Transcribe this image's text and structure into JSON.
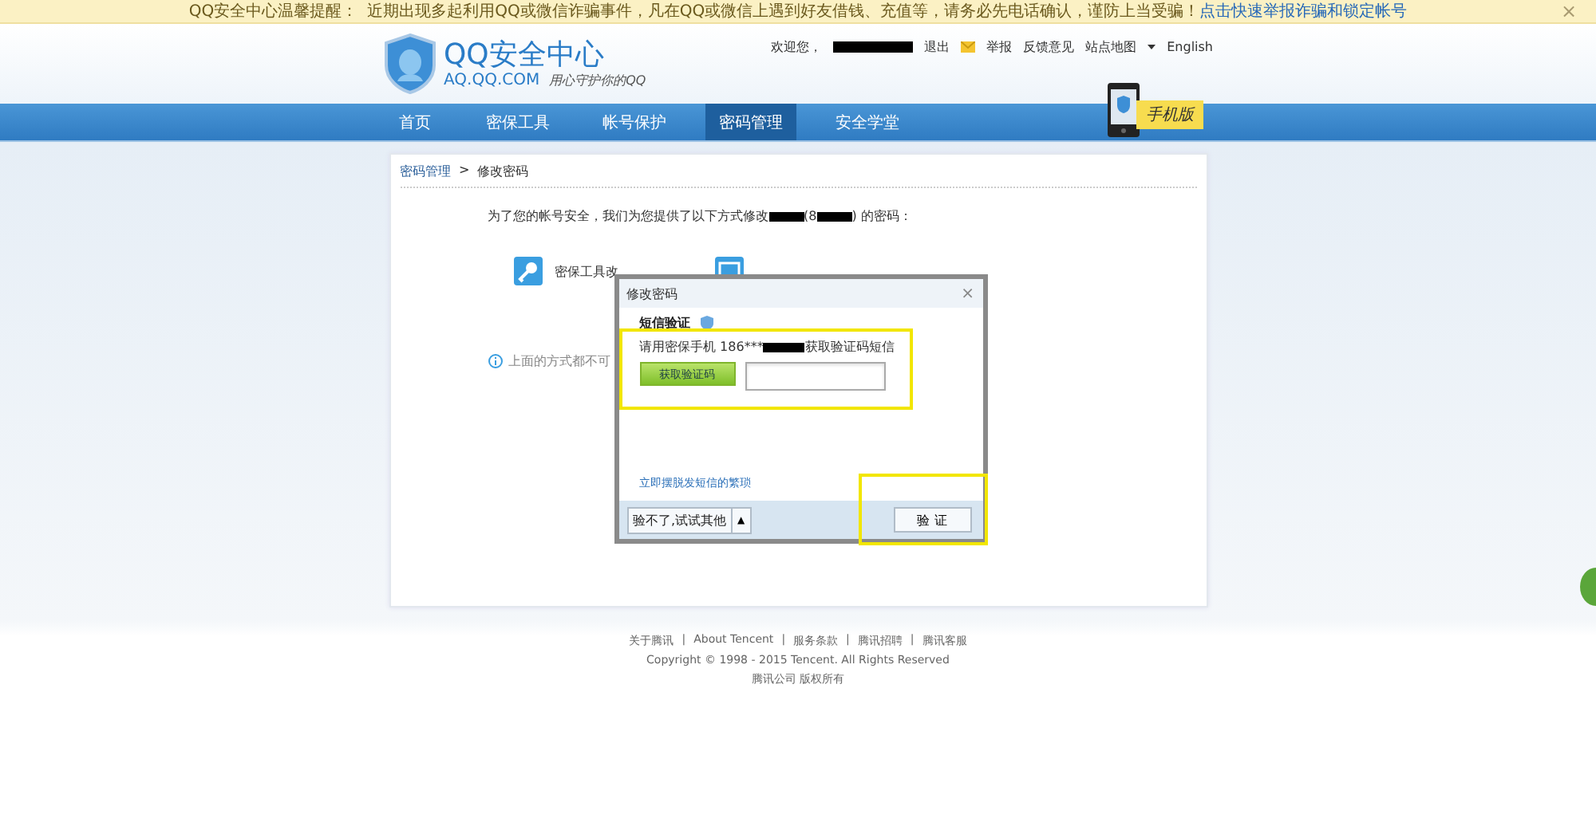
{
  "notice": {
    "label": "QQ安全中心温馨提醒：",
    "text": "近期出现多起利用QQ或微信诈骗事件，凡在QQ或微信上遇到好友借钱、充值等，请务必先电话确认，谨防上当受骗！",
    "link": "点击快速举报诈骗和锁定帐号",
    "close": "×"
  },
  "logo": {
    "title": "QQ安全中心",
    "domain": "AQ.QQ.COM",
    "slogan": "用心守护你的QQ"
  },
  "top_links": {
    "welcome": "欢迎您，",
    "items": [
      {
        "label": "退出",
        "kind": "link"
      },
      {
        "label": "举报",
        "kind": "mail-link"
      },
      {
        "label": "反馈意见",
        "kind": "link"
      },
      {
        "label": "站点地图",
        "kind": "dropdown"
      },
      {
        "label": "English",
        "kind": "link"
      }
    ]
  },
  "nav": [
    {
      "label": "首页",
      "selected": false
    },
    {
      "label": "密保工具",
      "selected": false
    },
    {
      "label": "帐号保护",
      "selected": false
    },
    {
      "label": "密码管理",
      "selected": true
    },
    {
      "label": "安全学堂",
      "selected": false
    }
  ],
  "mobile_badge": "手机版",
  "breadcrumb": {
    "items": [
      "密码管理",
      "修改密码"
    ],
    "separator": ">"
  },
  "intro": [
    {
      "kind": "text",
      "text": "为了您的帐号安全，我们为您提供了以下方式修改"
    },
    {
      "kind": "redacted"
    },
    {
      "kind": "text",
      "text": "(8"
    },
    {
      "kind": "redacted"
    },
    {
      "kind": "text",
      "text": ") 的密码："
    }
  ],
  "options": [
    {
      "kind": "key",
      "label": "密保工具改"
    },
    {
      "kind": "sms"
    }
  ],
  "note": "上面的方式都不可",
  "dialog": {
    "title": "修改密码",
    "close": "×",
    "heading": "短信验证",
    "phone_line": [
      {
        "kind": "text",
        "text": "请用密保手机 186***"
      },
      {
        "kind": "redacted"
      },
      {
        "kind": "text",
        "text": "获取验证码短信"
      }
    ],
    "get_code_button": "获取验证码",
    "link": "立即摆脱发短信的繁琐",
    "alt_button": "验不了,试试其他",
    "alt_caret": "▲",
    "verify_button": "验 证"
  },
  "footer": {
    "links": [
      "关于腾讯",
      "About Tencent",
      "服务条款",
      "腾讯招聘",
      "腾讯客服"
    ],
    "separator": "|",
    "copyright": "Copyright © 1998 - 2015 Tencent. All Rights Reserved",
    "company": "腾讯公司 版权所有"
  }
}
